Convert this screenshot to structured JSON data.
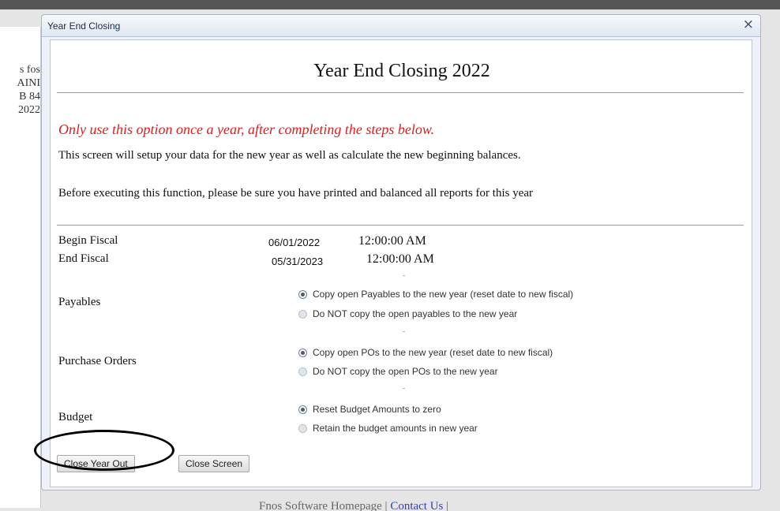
{
  "background": {
    "left_lines": [
      "s fos",
      "AINI",
      "B 84",
      "2022"
    ],
    "footer_text": "Fnos Software Homepage |",
    "footer_link": "Contact Us",
    "footer_trail": "|"
  },
  "dialog": {
    "title": "Year End Closing",
    "close_glyph": "×",
    "heading": "Year End Closing 2022",
    "warning": "Only use this option once a year, after completing the steps below.",
    "para1": "This screen will setup your data for the new year as well as calculate the new beginning balances.",
    "para2": "Before executing this function, please be sure you have printed and balanced all reports for this year"
  },
  "fiscal": {
    "begin_label": "Begin Fiscal",
    "begin_date": "06/01/2022",
    "begin_time": "12:00:00 AM",
    "end_label": "End Fiscal",
    "end_date": "05/31/2023",
    "end_time": "12:00:00 AM",
    "separator": "-"
  },
  "sections": {
    "payables": {
      "label": "Payables",
      "options": [
        "Copy open Payables to the new year (reset date to new fiscal)",
        "Do NOT copy the open payables to the new year"
      ]
    },
    "purchase_orders": {
      "label": "Purchase Orders",
      "options": [
        "Copy open POs to the new year (reset date to new fiscal)",
        "Do NOT copy the open POs to the new year"
      ]
    },
    "budget": {
      "label": "Budget",
      "options": [
        "Reset Budget Amounts to zero",
        "Retain the budget amounts in new year"
      ]
    }
  },
  "buttons": {
    "close_year_out": "Close Year Out",
    "close_screen": "Close Screen"
  }
}
